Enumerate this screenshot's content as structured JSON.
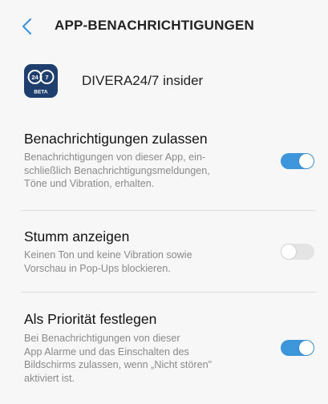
{
  "header": {
    "title": "APP-BENACHRICHTIGUNGEN"
  },
  "app": {
    "name": "DIVERA24/7 insider",
    "icon_badge": "BETA",
    "icon_left_text": "24",
    "icon_right_text": "7"
  },
  "settings": [
    {
      "title": "Benachrichtigungen zulassen",
      "description": "Benachrichtigungen von dieser App, ein-\nschließlich Benachrichtigungsmeldungen,\nTöne und Vibration, erhalten.",
      "enabled": true
    },
    {
      "title": "Stumm anzeigen",
      "description": "Keinen Ton und keine Vibration sowie\nVorschau in Pop-Ups blockieren.",
      "enabled": false
    },
    {
      "title": "Als Priorität festlegen",
      "description": "Bei Benachrichtigungen von dieser\nApp Alarme und das Einschalten des\nBildschirms zulassen, wenn „Nicht stören\"\naktiviert ist.",
      "enabled": true
    }
  ],
  "colors": {
    "accent": "#3d95da",
    "toggle_off": "#e4e4e4",
    "background": "#f7f7f7",
    "app_icon_bg": "#1e3f6d"
  },
  "icons": {
    "back": "chevron-left-icon",
    "app": "divera-app-icon"
  }
}
